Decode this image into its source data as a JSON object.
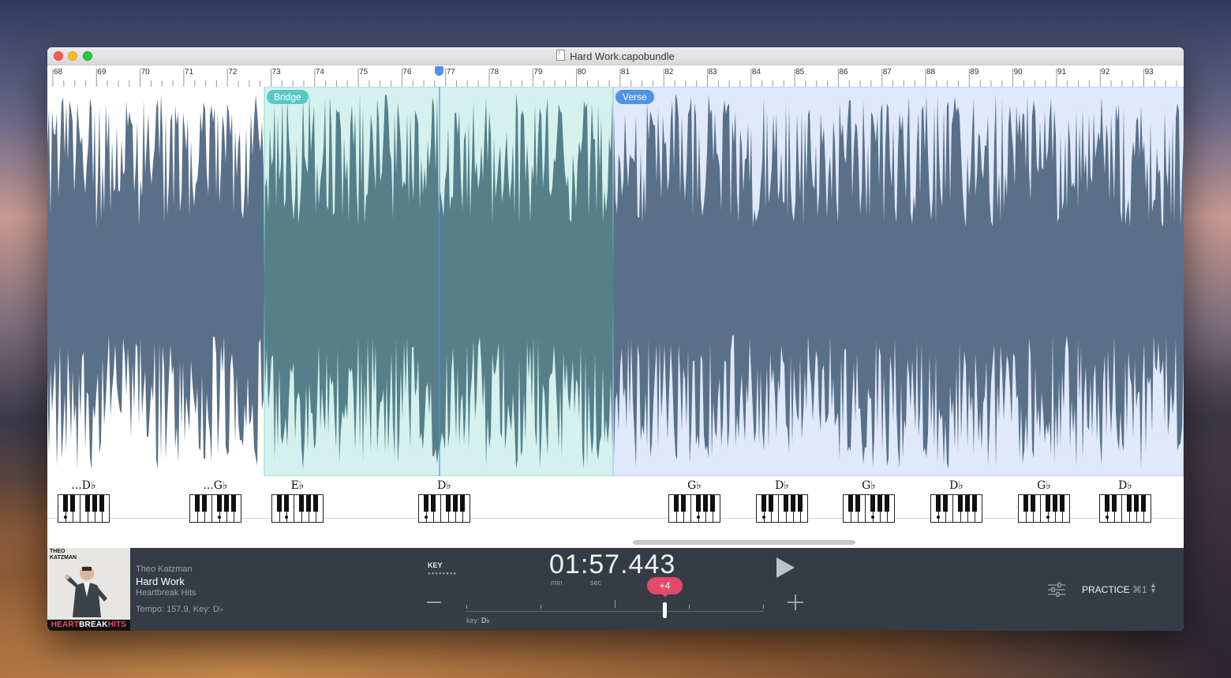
{
  "window": {
    "title": "Hard Work.capobundle"
  },
  "ruler": {
    "bars": [
      68,
      69,
      70,
      71,
      72,
      73,
      74,
      75,
      76,
      77,
      78,
      79,
      80,
      81,
      82,
      83,
      84,
      85,
      86,
      87,
      88,
      89,
      90,
      91,
      92,
      93
    ]
  },
  "sections": [
    {
      "name": "Bridge",
      "color": "#58c8c6"
    },
    {
      "name": "Verse",
      "color": "#4f93e6"
    }
  ],
  "chords": [
    {
      "name": "...D♭",
      "root": "Db"
    },
    {
      "name": "...G♭",
      "root": "Gb"
    },
    {
      "name": "E♭",
      "root": "Eb"
    },
    {
      "name": "D♭",
      "root": "Db"
    },
    {
      "name": "G♭",
      "root": "Gb"
    },
    {
      "name": "D♭",
      "root": "Db"
    },
    {
      "name": "G♭",
      "root": "Gb"
    },
    {
      "name": "D♭",
      "root": "Db"
    },
    {
      "name": "G♭",
      "root": "Gb"
    },
    {
      "name": "D♭",
      "root": "Db"
    }
  ],
  "song": {
    "artist": "Theo Katzman",
    "title": "Hard Work",
    "album": "Heartbreak Hits",
    "tempo_key": "Tempo: 157.9, Key: D♭"
  },
  "album_art": {
    "artist_text": "THEO KATZMAN",
    "title_part1": "HEART",
    "title_part2": "BREAK",
    "title_part3": "HITS"
  },
  "transport": {
    "key_label": "KEY",
    "time": "01:57.443",
    "min_label": "min",
    "sec_label": "sec",
    "transpose": "+4",
    "key_prefix": "key:",
    "key_value": "D♭"
  },
  "mode": {
    "label": "PRACTICE",
    "shortcut": "⌘1"
  },
  "icons": [
    "play-icon",
    "minus-icon",
    "plus-icon",
    "mixer-icon",
    "updown-arrows-icon"
  ]
}
